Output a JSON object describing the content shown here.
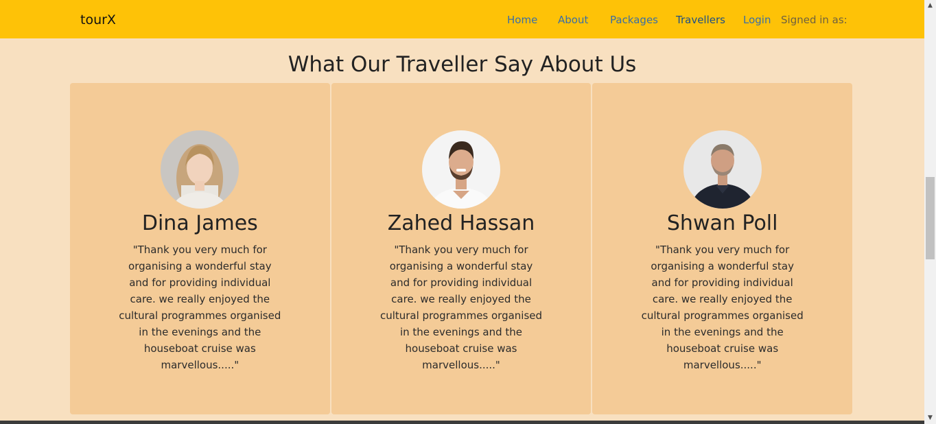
{
  "nav": {
    "brand": "tourX",
    "links": [
      "Home",
      "About",
      "Packages",
      "Travellers",
      "Login"
    ],
    "signed_in": "Signed in as:"
  },
  "section": {
    "title": "What Our Traveller Say About Us"
  },
  "testimonials": [
    {
      "name": "Dina James",
      "quote": "\"Thank you very much for organising a wonderful stay and for providing individual care. we really enjoyed the cultural programmes organised in the evenings and the houseboat cruise was marvellous.....\""
    },
    {
      "name": "Zahed Hassan",
      "quote": "\"Thank you very much for organising a wonderful stay and for providing individual care. we really enjoyed the cultural programmes organised in the evenings and the houseboat cruise was marvellous.....\""
    },
    {
      "name": "Shwan Poll",
      "quote": "\"Thank you very much for organising a wonderful stay and for providing individual care. we really enjoyed the cultural programmes organised in the evenings and the houseboat cruise was marvellous.....\""
    }
  ],
  "colors": {
    "navbar": "#fec207",
    "page_background": "#f8e0c0",
    "card_background": "#f4cb97",
    "link": "#3a6ea5"
  },
  "icons": [
    "scroll-up-arrow-icon",
    "scroll-down-arrow-icon"
  ]
}
